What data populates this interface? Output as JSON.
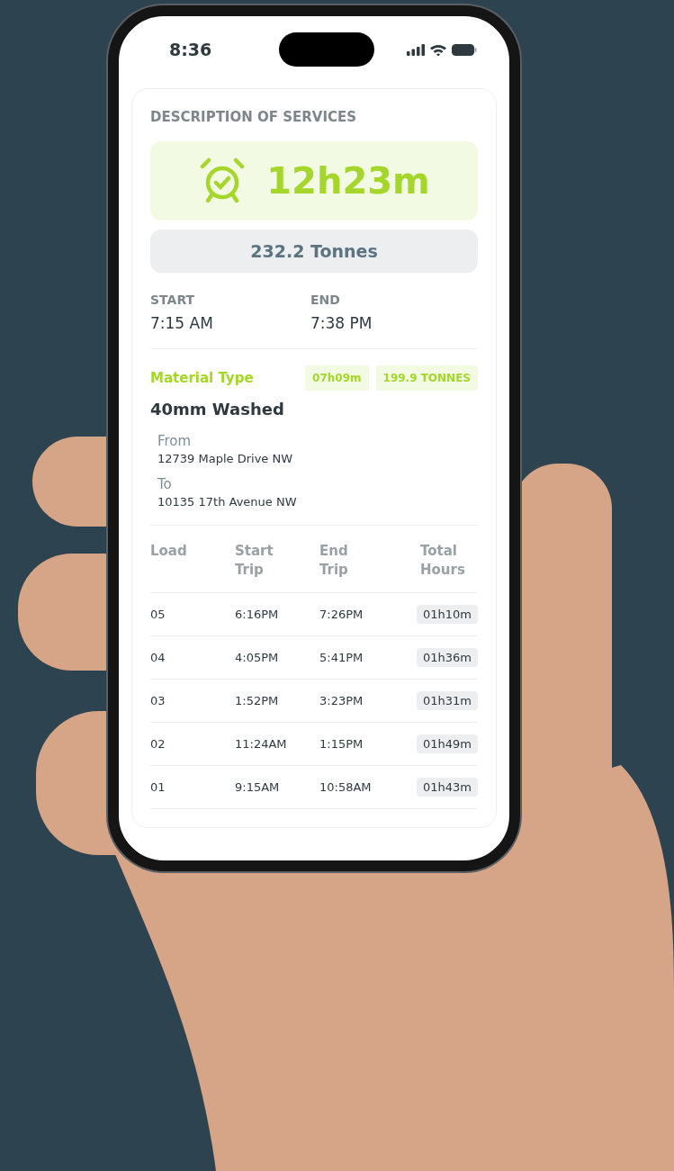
{
  "status_bar": {
    "time": "8:36"
  },
  "section_title": "DESCRIPTION OF SERVICES",
  "duration": "12h23m",
  "total_weight": "232.2 Tonnes",
  "times": [
    {
      "label": "START",
      "value": "7:15 AM"
    },
    {
      "label": "END",
      "value": "7:38 PM"
    }
  ],
  "material": {
    "label": "Material Type",
    "badges": [
      "07h09m",
      "199.9 TONNES"
    ],
    "name": "40mm Washed",
    "route": [
      {
        "label": "From",
        "address": "12739 Maple Drive NW"
      },
      {
        "label": "To",
        "address": "10135 17th Avenue NW"
      }
    ]
  },
  "table": {
    "columns": [
      "Load",
      "Start Trip",
      "End Trip",
      "Total Hours"
    ],
    "rows": [
      [
        "05",
        "6:16PM",
        "7:26PM",
        "01h10m"
      ],
      [
        "04",
        "4:05PM",
        "5:41PM",
        "01h36m"
      ],
      [
        "03",
        "1:52PM",
        "3:23PM",
        "01h31m"
      ],
      [
        "02",
        "11:24AM",
        "1:15PM",
        "01h49m"
      ],
      [
        "01",
        "9:15AM",
        "10:58AM",
        "01h43m"
      ]
    ]
  }
}
